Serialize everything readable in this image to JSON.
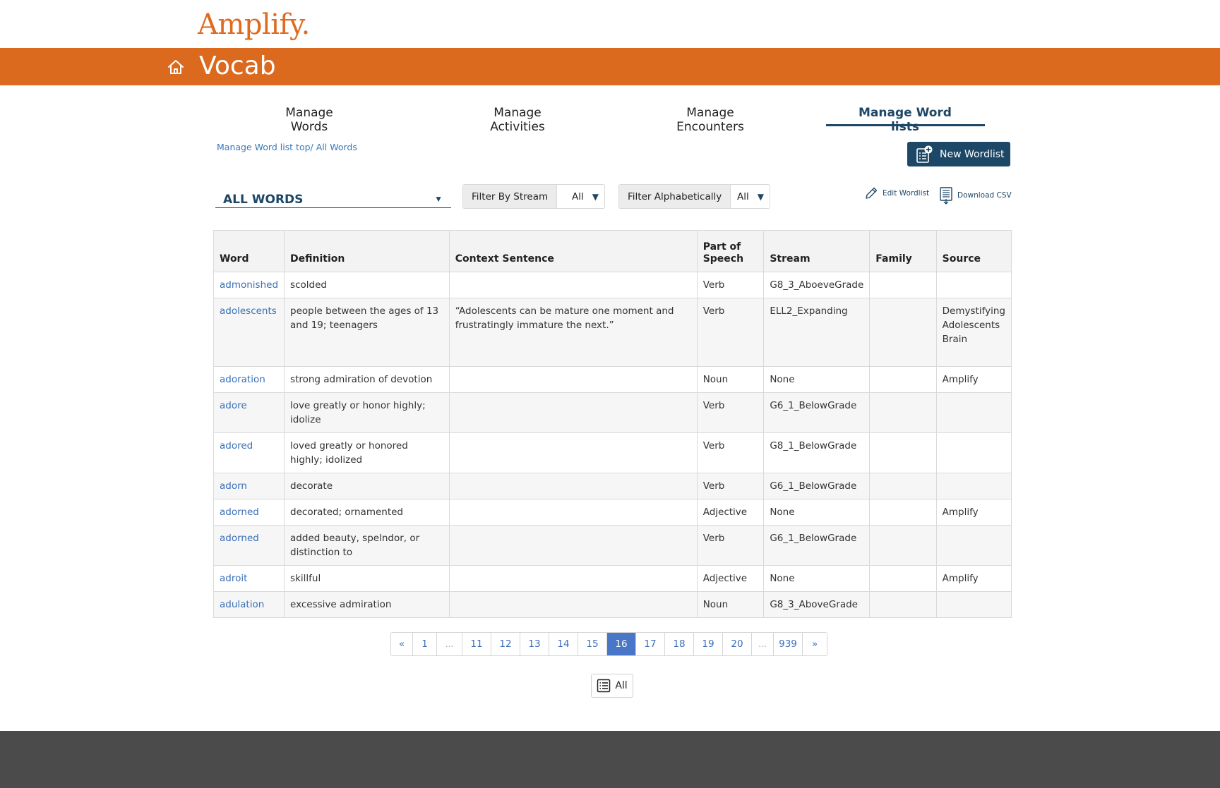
{
  "brand": {
    "logo": "Amplify.",
    "app_title": "Vocab"
  },
  "tabs": [
    {
      "label": "Manage Words"
    },
    {
      "label": "Manage Activities"
    },
    {
      "label": "Manage Encounters"
    },
    {
      "label": "Manage Word lists"
    }
  ],
  "active_tab": "Manage Word lists",
  "breadcrumb": "Manage Word list top/ All Words",
  "new_wordlist_label": "New Wordlist",
  "wordlist_selector": {
    "value": "ALL WORDS"
  },
  "filters": {
    "stream": {
      "label": "Filter By Stream",
      "value": "All"
    },
    "alpha": {
      "label": "Filter Alphabetically",
      "value": "All"
    }
  },
  "actions": {
    "edit": "Edit Wordlist",
    "download": "Download CSV"
  },
  "table": {
    "headers": [
      "Word",
      "Definition",
      "Context Sentence",
      "Part of Speech",
      "Stream",
      "Family",
      "Source"
    ],
    "rows": [
      [
        "admonished",
        "scolded",
        "",
        "Verb",
        "G8_3_AboeveGrade",
        "",
        ""
      ],
      [
        "adolescents",
        "people between the ages of 13 and 19; teenagers",
        "“Adolescents can be mature one moment and frustratingly immature the next.”",
        "Verb",
        "ELL2_Expanding",
        "",
        "Demystifying Adolescents Brain"
      ],
      [
        "adoration",
        "strong admiration of devotion",
        "",
        "Noun",
        "None",
        "",
        "Amplify"
      ],
      [
        "adore",
        "love greatly or honor highly; idolize",
        "",
        "Verb",
        "G6_1_BelowGrade",
        "",
        ""
      ],
      [
        "adored",
        "loved greatly or honored highly; idolized",
        "",
        "Verb",
        "G8_1_BelowGrade",
        "",
        ""
      ],
      [
        "adorn",
        "decorate",
        "",
        "Verb",
        "G6_1_BelowGrade",
        "",
        ""
      ],
      [
        "adorned",
        "decorated; ornamented",
        "",
        "Adjective",
        "None",
        "",
        "Amplify"
      ],
      [
        "adorned",
        "added beauty, spelndor, or distinction to",
        "",
        "Verb",
        "G6_1_BelowGrade",
        "",
        ""
      ],
      [
        "adroit",
        "skillful",
        "",
        "Adjective",
        "None",
        "",
        "Amplify"
      ],
      [
        "adulation",
        "excessive admiration",
        "",
        "Noun",
        "G8_3_AboveGrade",
        "",
        ""
      ]
    ]
  },
  "pagination": {
    "pages": [
      "«",
      "1",
      "...",
      "11",
      "12",
      "13",
      "14",
      "15",
      "16",
      "17",
      "18",
      "19",
      "20",
      "...",
      "939",
      "»"
    ],
    "current": "16"
  },
  "show_all_label": "All",
  "colors": {
    "brand_orange": "#db6a1f",
    "navy": "#1d4766",
    "link_blue": "#3a6fb8",
    "active_page": "#4a76c7",
    "footer": "#4b4b4b"
  }
}
